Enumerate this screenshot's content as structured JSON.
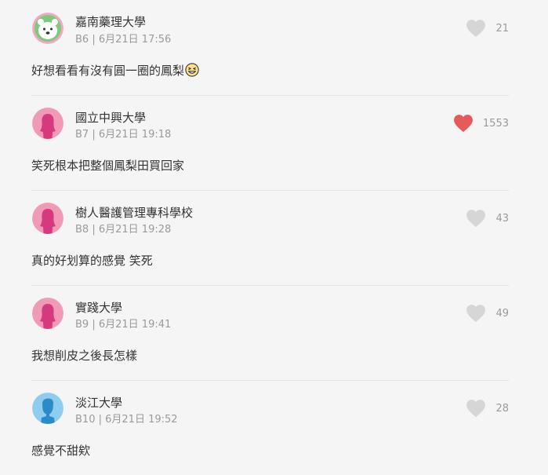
{
  "comments": [
    {
      "school": "嘉南藥理大學",
      "floor": "B6",
      "datetime": "6月21日 17:56",
      "text": "好想看看有沒有圓一圈的鳳梨",
      "likes": "21",
      "liked": false,
      "avatar": "bear-avatar"
    },
    {
      "school": "國立中興大學",
      "floor": "B7",
      "datetime": "6月21日 19:18",
      "text": "笑死根本把整個鳳梨田買回家",
      "likes": "1553",
      "liked": true,
      "avatar": "female-avatar"
    },
    {
      "school": "樹人醫護管理專科學校",
      "floor": "B8",
      "datetime": "6月21日 19:28",
      "text": "真的好划算的感覺 笑死",
      "likes": "43",
      "liked": false,
      "avatar": "female-avatar"
    },
    {
      "school": "實踐大學",
      "floor": "B9",
      "datetime": "6月21日 19:41",
      "text": "我想削皮之後長怎樣",
      "likes": "49",
      "liked": false,
      "avatar": "female-avatar"
    },
    {
      "school": "淡江大學",
      "floor": "B10",
      "datetime": "6月21日 19:52",
      "text": "感覺不甜欸",
      "likes": "28",
      "liked": false,
      "avatar": "male-avatar"
    }
  ],
  "colors": {
    "heart_liked": "#e65a5a",
    "heart_default": "#d6d6d6",
    "female_avatar_bg": "#f19ab6",
    "female_avatar_fg": "#d43a7d",
    "male_avatar_bg": "#8ecdf0",
    "male_avatar_fg": "#2a8bc9",
    "bear_avatar_bg": "#7fc97f"
  },
  "icons": {
    "like": "heart-icon",
    "emoji": "laughing-emoji-icon"
  }
}
